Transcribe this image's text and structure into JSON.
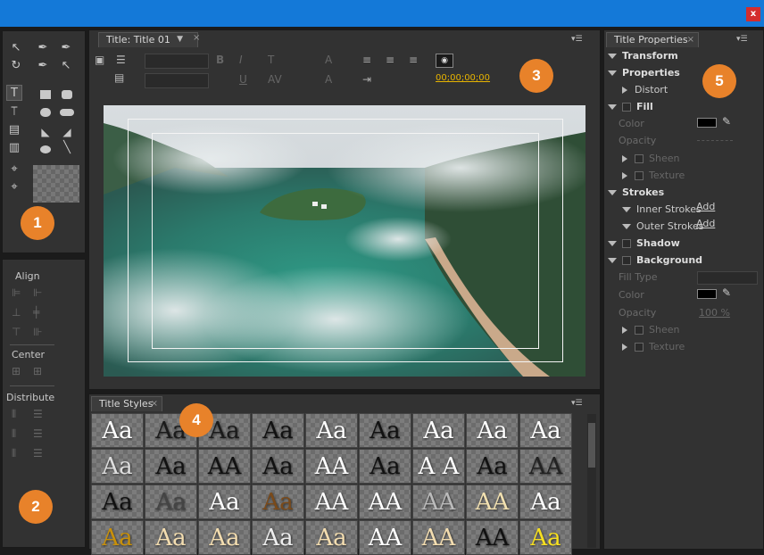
{
  "window": {
    "close_label": "x"
  },
  "badges": {
    "b1": "1",
    "b2": "2",
    "b3": "3",
    "b4": "4",
    "b5": "5"
  },
  "align_panel": {
    "align": "Align",
    "center": "Center",
    "distribute": "Distribute"
  },
  "title_panel": {
    "tab_label": "Title: Title 01",
    "timecode": "00;00;00;00"
  },
  "styles_panel": {
    "tab_label": "Title Styles",
    "samples": [
      [
        "Aa",
        "Aa",
        "Aa",
        "Aa",
        "Aa",
        "Aa",
        "Aa",
        "Aa",
        "Aa"
      ],
      [
        "Aa",
        "Aa",
        "AA",
        "Aa",
        "AA",
        "Aa",
        "A A",
        "Aa",
        "AA"
      ],
      [
        "Aa",
        "Aa",
        "Aa",
        "Aa",
        "AA",
        "AA",
        "AA",
        "AA",
        "Aa"
      ],
      [
        "Aa",
        "Aa",
        "Aa",
        "Aa",
        "Aa",
        "AA",
        "AA",
        "AA",
        "Aa"
      ]
    ],
    "colors": [
      [
        "#ffffff",
        "#1a1a1a",
        "#1a1a1a",
        "#111111",
        "#ffffff",
        "#111111",
        "#ffffff",
        "#ffffff",
        "#ffffff"
      ],
      [
        "#dddddd",
        "#111111",
        "#111111",
        "#111111",
        "#ffffff",
        "#111111",
        "#ffffff",
        "#111111",
        "#222222"
      ],
      [
        "#111111",
        "#444444",
        "#ffffff",
        "#7a4a1a",
        "#ffffff",
        "#ffffff",
        "#bbbbbb",
        "#f1e0b0",
        "#ffffff"
      ],
      [
        "#c8900a",
        "#f3ddb0",
        "#f3ddb0",
        "#eeeeee",
        "#f3ddb0",
        "#ffffff",
        "#f3ddb0",
        "#111111",
        "#f7e020"
      ]
    ]
  },
  "props_panel": {
    "tab_label": "Title Properties",
    "transform": "Transform",
    "properties": "Properties",
    "distort": "Distort",
    "fill": "Fill",
    "color": "Color",
    "opacity": "Opacity",
    "sheen": "Sheen",
    "texture": "Texture",
    "strokes": "Strokes",
    "inner_strokes": "Inner Strokes",
    "outer_strokes": "Outer Strokes",
    "add": "Add",
    "shadow": "Shadow",
    "background": "Background",
    "fill_type": "Fill Type",
    "bg_color": "Color",
    "bg_opacity": "Opacity",
    "bg_opacity_value": "100 %",
    "bg_sheen": "Sheen",
    "bg_texture": "Texture"
  },
  "colors": {
    "accent": "#e8822a",
    "titlebar": "#1479d8",
    "timecode": "#e8b400"
  }
}
